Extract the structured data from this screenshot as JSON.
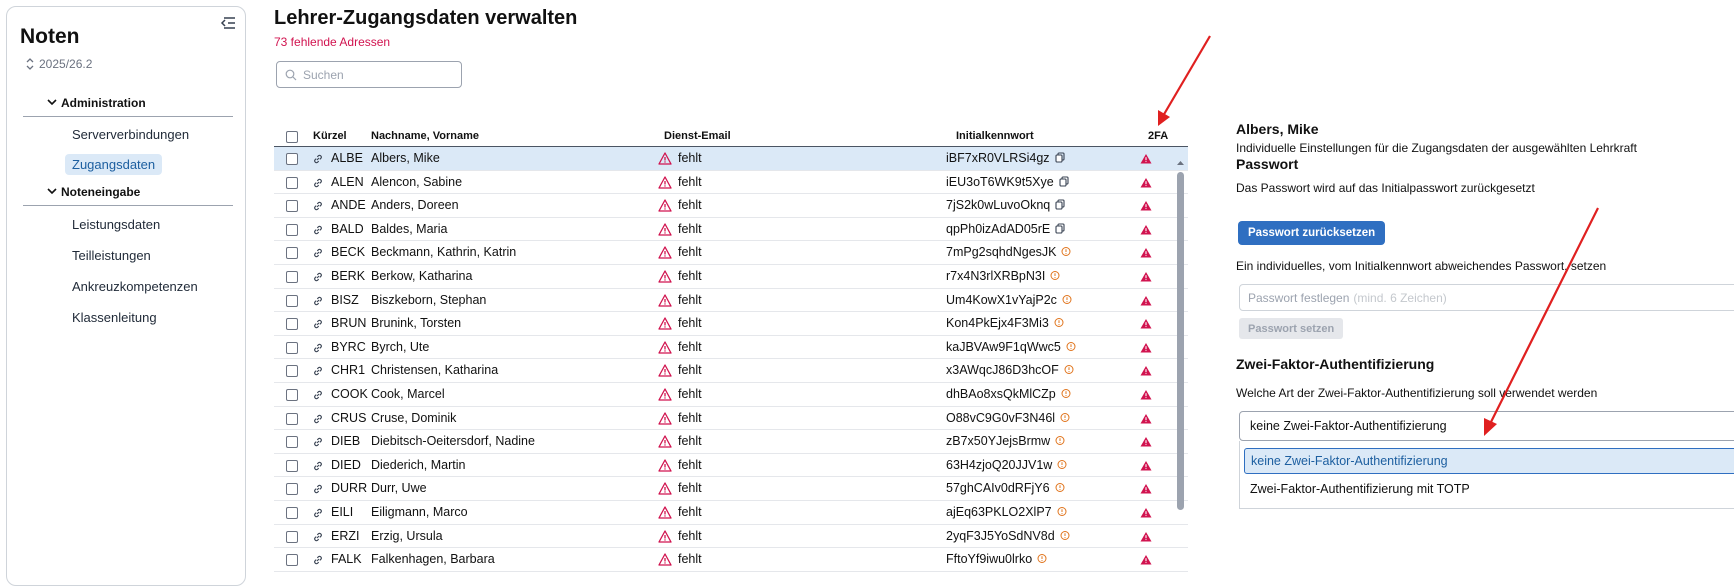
{
  "sidebar": {
    "app_title": "Noten",
    "version": "2025/26.2",
    "groups": [
      {
        "label": "Administration",
        "items": [
          "Serververbindungen",
          "Zugangsdaten"
        ]
      },
      {
        "label": "Noteneingabe",
        "items": [
          "Leistungsdaten",
          "Teilleistungen",
          "Ankreuzkompetenzen",
          "Klassenleitung"
        ]
      }
    ],
    "active_item": "Zugangsdaten"
  },
  "main": {
    "title": "Lehrer-Zugangsdaten verwalten",
    "missing_count": "73 fehlende Adressen",
    "search_placeholder": "Suchen",
    "columns": {
      "kuerzel": "Kürzel",
      "name": "Nachname, Vorname",
      "email": "Dienst-Email",
      "password": "Initialkennwort",
      "twofa": "2FA"
    },
    "rows": [
      {
        "kuerzel": "ALBE",
        "name": "Albers, Mike",
        "email": "fehlt",
        "password": "iBF7xR0VLRSi4gz",
        "pw_icon": "copy-icon",
        "selected": true
      },
      {
        "kuerzel": "ALEN",
        "name": "Alencon, Sabine",
        "email": "fehlt",
        "password": "iEU3oT6WK9t5Xye",
        "pw_icon": "copy-icon"
      },
      {
        "kuerzel": "ANDE",
        "name": "Anders, Doreen",
        "email": "fehlt",
        "password": "7jS2k0wLuvoOknq",
        "pw_icon": "copy-icon"
      },
      {
        "kuerzel": "BALD",
        "name": "Baldes, Maria",
        "email": "fehlt",
        "password": "qpPh0izAdAD05rE",
        "pw_icon": "copy-icon"
      },
      {
        "kuerzel": "BECK",
        "name": "Beckmann, Kathrin, Katrin",
        "email": "fehlt",
        "password": "7mPg2sqhdNgesJK",
        "pw_icon": "info-icon"
      },
      {
        "kuerzel": "BERK",
        "name": "Berkow, Katharina",
        "email": "fehlt",
        "password": "r7x4N3rlXRBpN3I",
        "pw_icon": "info-icon"
      },
      {
        "kuerzel": "BISZ",
        "name": "Biszkeborn, Stephan",
        "email": "fehlt",
        "password": "Um4KowX1vYajP2c",
        "pw_icon": "info-icon"
      },
      {
        "kuerzel": "BRUN",
        "name": "Brunink, Torsten",
        "email": "fehlt",
        "password": "Kon4PkEjx4F3Mi3",
        "pw_icon": "info-icon"
      },
      {
        "kuerzel": "BYRC",
        "name": "Byrch, Ute",
        "email": "fehlt",
        "password": "kaJBVAw9F1qWwc5",
        "pw_icon": "info-icon"
      },
      {
        "kuerzel": "CHR1",
        "name": "Christensen, Katharina",
        "email": "fehlt",
        "password": "x3AWqcJ86D3hcOF",
        "pw_icon": "info-icon"
      },
      {
        "kuerzel": "COOK",
        "name": "Cook, Marcel",
        "email": "fehlt",
        "password": "dhBAo8xsQkMlCZp",
        "pw_icon": "info-icon"
      },
      {
        "kuerzel": "CRUS",
        "name": "Cruse, Dominik",
        "email": "fehlt",
        "password": "O88vC9G0vF3N46l",
        "pw_icon": "info-icon"
      },
      {
        "kuerzel": "DIEB",
        "name": "Diebitsch-Oeitersdorf, Nadine",
        "email": "fehlt",
        "password": "zB7x50YJejsBrmw",
        "pw_icon": "info-icon"
      },
      {
        "kuerzel": "DIED",
        "name": "Diederich, Martin",
        "email": "fehlt",
        "password": "63H4zjoQ20JJV1w",
        "pw_icon": "info-icon"
      },
      {
        "kuerzel": "DURR",
        "name": "Durr, Uwe",
        "email": "fehlt",
        "password": "57ghCAIv0dRFjY6",
        "pw_icon": "info-icon"
      },
      {
        "kuerzel": "EILI",
        "name": "Eiligmann, Marco",
        "email": "fehlt",
        "password": "ajEq63PKLO2XlP7",
        "pw_icon": "info-icon"
      },
      {
        "kuerzel": "ERZI",
        "name": "Erzig, Ursula",
        "email": "fehlt",
        "password": "2yqF3J5YoSdNV8d",
        "pw_icon": "info-icon"
      },
      {
        "kuerzel": "FALK",
        "name": "Falkenhagen, Barbara",
        "email": "fehlt",
        "password": "FftoYf9iwu0lrko",
        "pw_icon": "info-icon"
      }
    ]
  },
  "detail": {
    "name": "Albers, Mike",
    "description": "Individuelle Einstellungen für die Zugangsdaten der ausgewählten Lehrkraft",
    "password_heading": "Passwort",
    "reset_text": "Das Passwort wird auf das Initialpasswort zurückgesetzt",
    "reset_button": "Passwort zurücksetzen",
    "custom_text": "Ein individuelles, vom Initialkennwort abweichendes Passwort, setzen",
    "password_placeholder": "Passwort festlegen",
    "password_hint": "(mind. 6 Zeichen)",
    "set_button": "Passwort setzen",
    "twofa_heading": "Zwei-Faktor-Authentifizierung",
    "twofa_question": "Welche Art der Zwei-Faktor-Authentifizierung soll verwendet werden",
    "twofa_selected": "keine Zwei-Faktor-Authentifizierung",
    "twofa_options": [
      "keine Zwei-Faktor-Authentifizierung",
      "Zwei-Faktor-Authentifizierung mit TOTP"
    ]
  },
  "colors": {
    "accent": "#2f6fc1",
    "warning": "#d1134f",
    "selection": "#dbe9f7",
    "annotation_arrow": "#e02020"
  }
}
